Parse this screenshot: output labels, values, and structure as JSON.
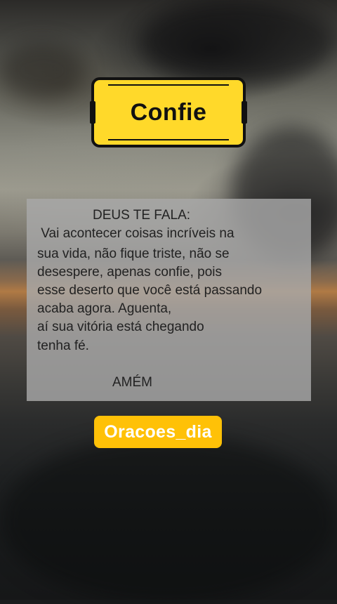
{
  "title": "Confie",
  "message": {
    "heading": "DEUS TE FALA:",
    "lines": [
      " Vai acontecer coisas incríveis na",
      "sua vida, não fique triste, não se",
      "desespere, apenas confie, pois",
      "esse deserto que você está passando",
      "acaba agora. Aguenta,",
      "aí sua vitória está chegando",
      "tenha fé."
    ],
    "closing": "AMÉM"
  },
  "handle": "Oracoes_dia",
  "colors": {
    "title_badge": "#ffd92a",
    "handle_badge": "#ffc107",
    "panel": "#a8a8a8"
  }
}
